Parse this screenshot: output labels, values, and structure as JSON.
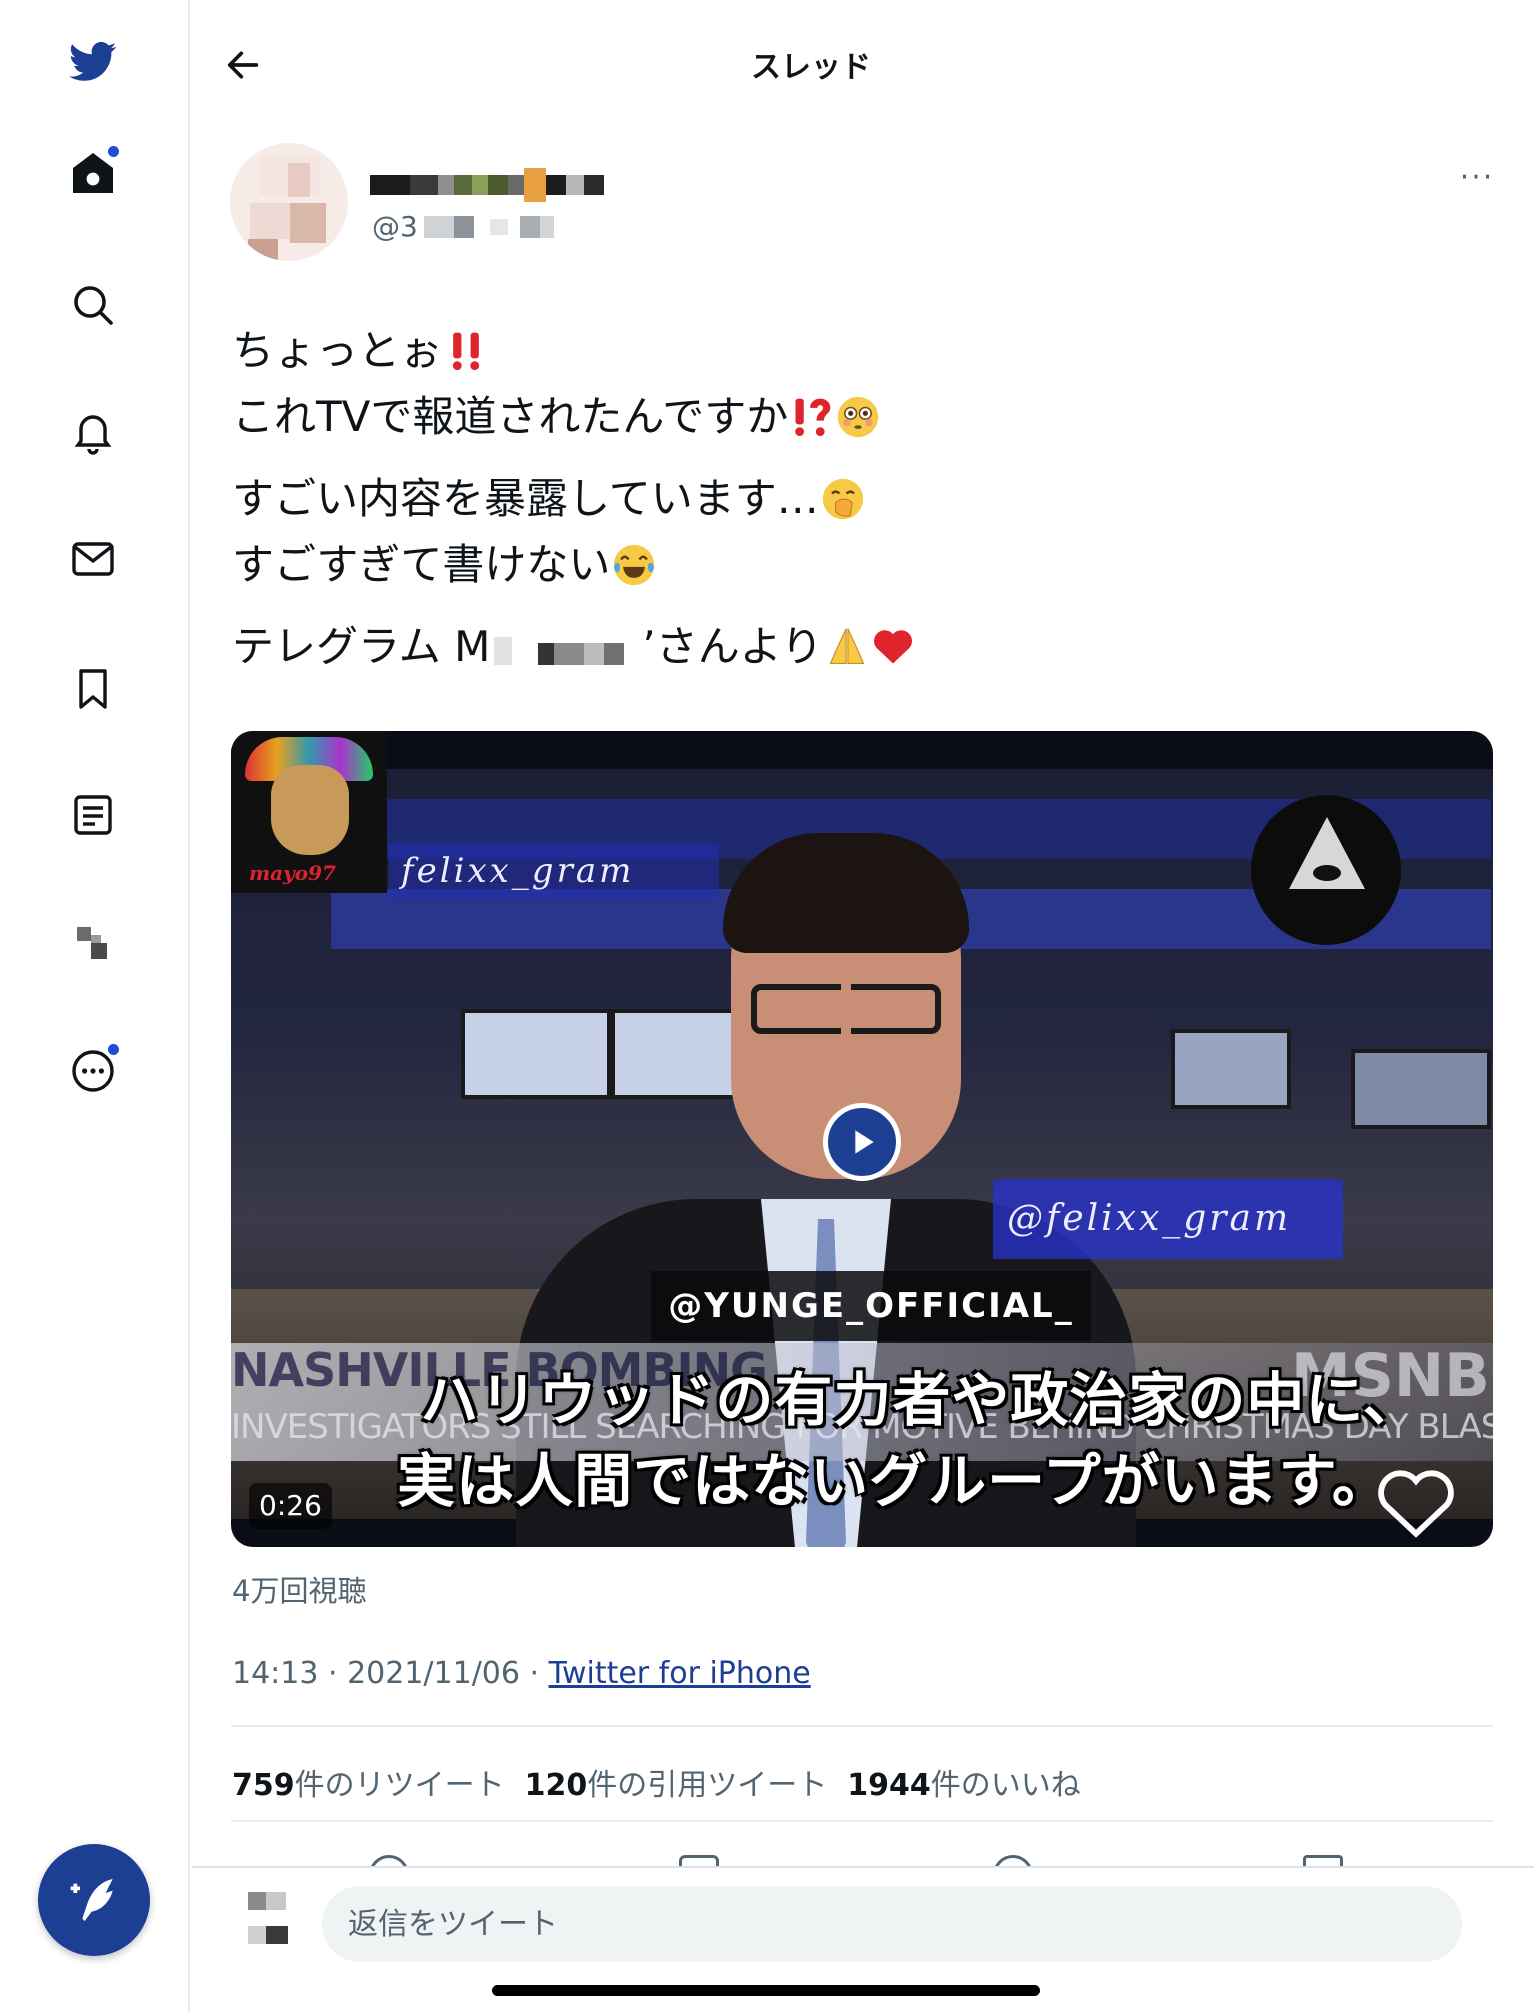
{
  "header": {
    "title": "スレッド"
  },
  "tweet": {
    "handle_prefix": "@3",
    "lines": [
      "ちょっとぉ",
      "これTVで報道されたんですか",
      "すごい内容を暴露しています…",
      "すごすぎて書けない",
      "テレグラム M",
      "’さんより"
    ],
    "more_label": "···"
  },
  "video": {
    "watermark_felix": "felixx_gram",
    "watermark_felix_at": "@felixx_gram",
    "watermark_yunge": "@YUNGE_OFFICIAL_",
    "channel_logo_text": "mayo97",
    "lower_third_1": "NASHVILLE BOMBING",
    "lower_third_2": "INVESTIGATORS STILL SEARCHING FOR MOTIVE BEHIND CHRISTMAS DAY BLAST",
    "network": "MSNBC",
    "subtitle_1": "ハリウッドの有力者や政治家の中に、",
    "subtitle_2": "実は人間ではないグループがいます。",
    "duration": "0:26"
  },
  "views": "4万回視聴",
  "meta": {
    "time_date": "14:13 · 2021/11/06 · ",
    "source": "Twitter for iPhone"
  },
  "stats": {
    "retweets_count": "759",
    "retweets_label": "件のリツイート",
    "quotes_count": "120",
    "quotes_label": "件の引用ツイート",
    "likes_count": "1944",
    "likes_label": "件のいいね"
  },
  "reply": {
    "placeholder": "返信をツイート"
  },
  "colors": {
    "accent": "#1d3f93",
    "secondary_text": "#536471"
  },
  "sidebar_icons": [
    "twitter-bird-icon",
    "home-icon",
    "search-icon",
    "bell-icon",
    "mail-icon",
    "bookmark-icon",
    "list-icon",
    "profile-icon",
    "more-circle-icon",
    "compose-icon"
  ]
}
